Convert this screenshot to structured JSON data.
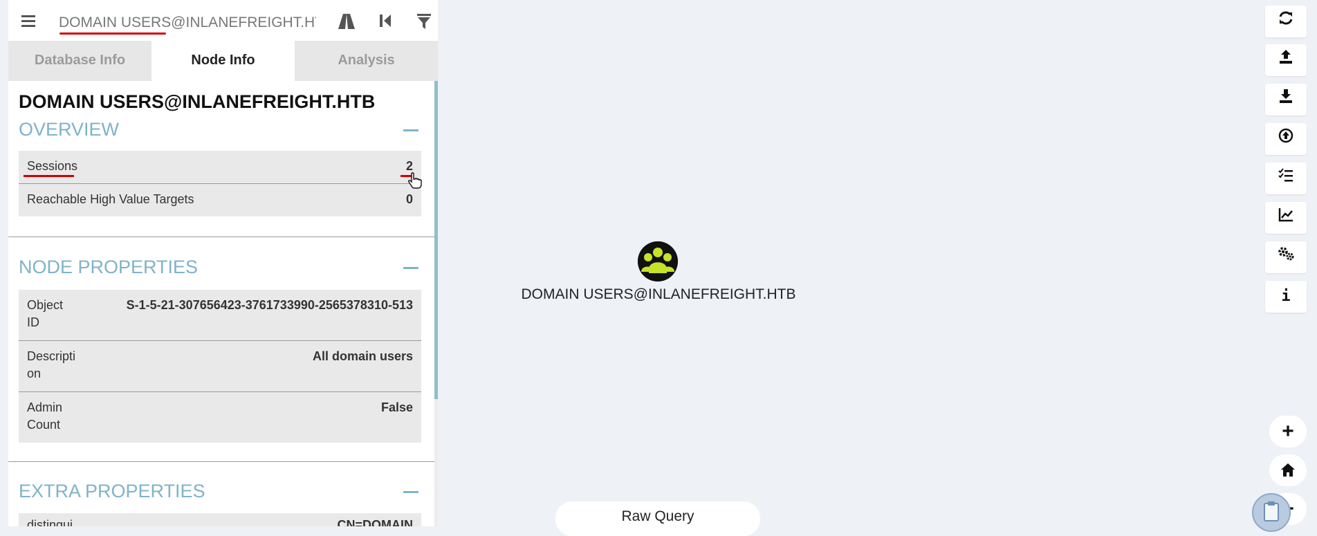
{
  "search": {
    "value": "DOMAIN USERS@INLANEFREIGHT.HTB"
  },
  "tabs": [
    {
      "label": "Database Info",
      "active": false
    },
    {
      "label": "Node Info",
      "active": true
    },
    {
      "label": "Analysis",
      "active": false
    }
  ],
  "node_info": {
    "title": "DOMAIN USERS@INLANEFREIGHT.HTB",
    "overview": {
      "title": "OVERVIEW",
      "rows": [
        {
          "key": "Sessions",
          "value": "2"
        },
        {
          "key": "Reachable High Value Targets",
          "value": "0"
        }
      ]
    },
    "node_properties": {
      "title": "NODE PROPERTIES",
      "rows": [
        {
          "key": "Object ID",
          "value": "S-1-5-21-307656423-3761733990-2565378310-513"
        },
        {
          "key": "Description",
          "value": "All domain users"
        },
        {
          "key": "Admin Count",
          "value": "False"
        }
      ]
    },
    "extra_properties": {
      "title": "EXTRA PROPERTIES",
      "rows": [
        {
          "key": "distingui",
          "value": "CN=DOMAIN"
        }
      ]
    }
  },
  "graph": {
    "node_label": "DOMAIN USERS@INLANEFREIGHT.HTB",
    "node_icon": "group-icon",
    "node_color": "#c8e22a"
  },
  "toolbar": {
    "buttons": [
      "refresh-icon",
      "export-icon",
      "import-icon",
      "upload-icon",
      "checklist-icon",
      "chart-icon",
      "settings-icon",
      "info-icon"
    ],
    "info_label": "i"
  },
  "zoom": {
    "plus": "+",
    "minus": "−",
    "home_icon": "home-icon"
  },
  "raw_query": {
    "label": "Raw Query"
  },
  "colors": {
    "accent": "#7fb3c8",
    "highlight": "#d60000",
    "background": "#eef1f6"
  }
}
